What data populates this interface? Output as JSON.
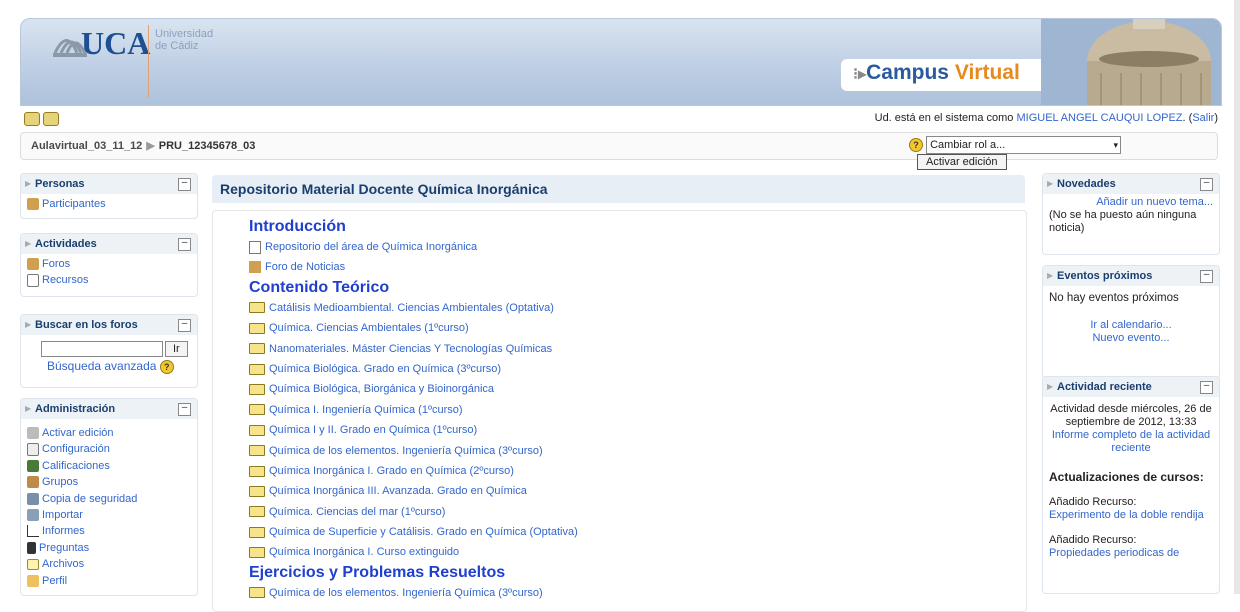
{
  "header": {
    "logo_text": "UCA",
    "logo_sub": [
      "Universidad",
      "de Cádiz"
    ],
    "campus_prefix": "Campus ",
    "campus_suffix": "Virtual"
  },
  "login": {
    "prefix": "Ud. está en el sistema como ",
    "user": "MIGUEL ANGEL CAUQUI LOPEZ",
    "logout_open": ". (",
    "logout": "Salir",
    "logout_close": ")"
  },
  "breadcrumb": {
    "items": [
      "Aulavirtual_03_11_12",
      "PRU_12345678_03"
    ]
  },
  "role": {
    "help": "?",
    "selected": "Cambiar rol a...",
    "edit_button": "Activar edición"
  },
  "left": {
    "personas": {
      "title": "Personas",
      "items": [
        "Participantes"
      ]
    },
    "actividades": {
      "title": "Actividades",
      "items": [
        "Foros",
        "Recursos"
      ]
    },
    "buscar": {
      "title": "Buscar en los foros",
      "input_value": "",
      "go": "Ir",
      "advanced": "Búsqueda avanzada",
      "help": "?"
    },
    "admin": {
      "title": "Administración",
      "items": [
        "Activar edición",
        "Configuración",
        "Calificaciones",
        "Grupos",
        "Copia de seguridad",
        "Importar",
        "Informes",
        "Preguntas",
        "Archivos",
        "Perfil"
      ]
    }
  },
  "center": {
    "title": "Repositorio Material Docente Química Inorgánica",
    "sections": [
      {
        "heading": "Introducción",
        "items": [
          {
            "icon": "file-icon",
            "text": "Repositorio del área de Química Inorgánica"
          },
          {
            "icon": "forum-icon",
            "text": "Foro de Noticias"
          }
        ]
      },
      {
        "heading": "Contenido Teórico",
        "items": [
          {
            "icon": "folder-icon",
            "text": "Catálisis Medioambiental. Ciencias Ambientales (Optativa)"
          },
          {
            "icon": "folder-icon",
            "text": "Química. Ciencias Ambientales (1ºcurso)"
          },
          {
            "icon": "folder-icon",
            "text": "Nanomateriales. Máster Ciencias Y Tecnologías Químicas"
          },
          {
            "icon": "folder-icon",
            "text": "Química Biológica. Grado en Química (3ºcurso)"
          },
          {
            "icon": "folder-icon",
            "text": "Química Biológica, Biorgánica y Bioinorgánica"
          },
          {
            "icon": "folder-icon",
            "text": "Química I. Ingeniería Química (1ºcurso)"
          },
          {
            "icon": "folder-icon",
            "text": "Química I y II. Grado en Química (1ºcurso)"
          },
          {
            "icon": "folder-icon",
            "text": "Química de los elementos. Ingeniería Química (3ºcurso)"
          },
          {
            "icon": "folder-icon",
            "text": "Química Inorgánica I. Grado en Química (2ºcurso)"
          },
          {
            "icon": "folder-icon",
            "text": "Química Inorgánica III. Avanzada. Grado en Química"
          },
          {
            "icon": "folder-icon",
            "text": "Química. Ciencias del mar (1ºcurso)"
          },
          {
            "icon": "folder-icon",
            "text": "Química de Superficie y Catálisis. Grado en Química (Optativa)"
          },
          {
            "icon": "folder-icon",
            "text": "Química Inorgánica I. Curso extinguido"
          }
        ]
      },
      {
        "heading": "Ejercicios y Problemas Resueltos",
        "items": [
          {
            "icon": "folder-icon",
            "text": "Química de los elementos. Ingeniería Química (3ºcurso)"
          }
        ]
      }
    ]
  },
  "right": {
    "novedades": {
      "title": "Novedades",
      "add": "Añadir un nuevo tema...",
      "empty": "(No se ha puesto aún ninguna noticia)"
    },
    "eventos": {
      "title": "Eventos próximos",
      "empty": "No hay eventos próximos",
      "calendar": "Ir al calendario...",
      "new_event": "Nuevo evento..."
    },
    "actividad": {
      "title": "Actividad reciente",
      "since": "Actividad desde miércoles, 26 de septiembre de 2012, 13:33",
      "report": "Informe completo de la actividad reciente",
      "updates": "Actualizaciones de cursos:",
      "added1_label": "Añadido Recurso:",
      "added1_link": "Experimento de la doble rendija",
      "added2_label": "Añadido Recurso:",
      "added2_link": "Propiedades periodicas de"
    }
  }
}
